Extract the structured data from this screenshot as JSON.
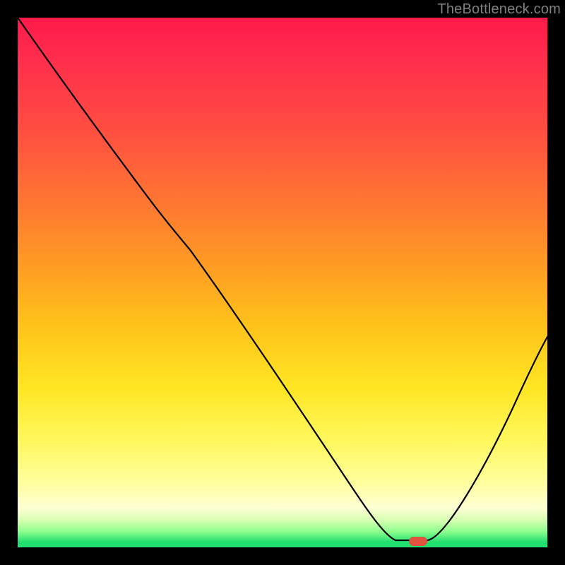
{
  "watermark": "TheBottleneck.com",
  "colors": {
    "page_background": "#000000",
    "gradient_top": "#ff1a4a",
    "gradient_mid": "#ffe623",
    "gradient_bottom": "#21e070",
    "curve": "#000000",
    "marker": "#e0533f",
    "watermark_text": "#808080"
  },
  "chart_data": {
    "type": "line",
    "title": "",
    "xlabel": "",
    "ylabel": "",
    "xlim": [
      0,
      100
    ],
    "ylim": [
      0,
      100
    ],
    "series": [
      {
        "name": "bottleneck-percent",
        "x": [
          0,
          5,
          10,
          15,
          20,
          25,
          30,
          35,
          40,
          45,
          50,
          55,
          60,
          65,
          68,
          71,
          76,
          78,
          82,
          86,
          90,
          95,
          100
        ],
        "values": [
          100,
          92,
          84,
          76,
          69,
          62,
          56,
          49,
          42,
          35,
          28,
          21,
          15,
          9,
          5,
          2,
          1,
          1,
          5,
          12,
          20,
          30,
          40
        ]
      }
    ],
    "annotations": [
      {
        "name": "optimal-point",
        "x": 76,
        "y": 1
      }
    ],
    "background": {
      "type": "vertical-gradient",
      "stops": [
        {
          "pct": 0,
          "color": "#ff1a4a"
        },
        {
          "pct": 50,
          "color": "#ffc21a"
        },
        {
          "pct": 85,
          "color": "#ffff90"
        },
        {
          "pct": 100,
          "color": "#21e070"
        }
      ]
    }
  }
}
